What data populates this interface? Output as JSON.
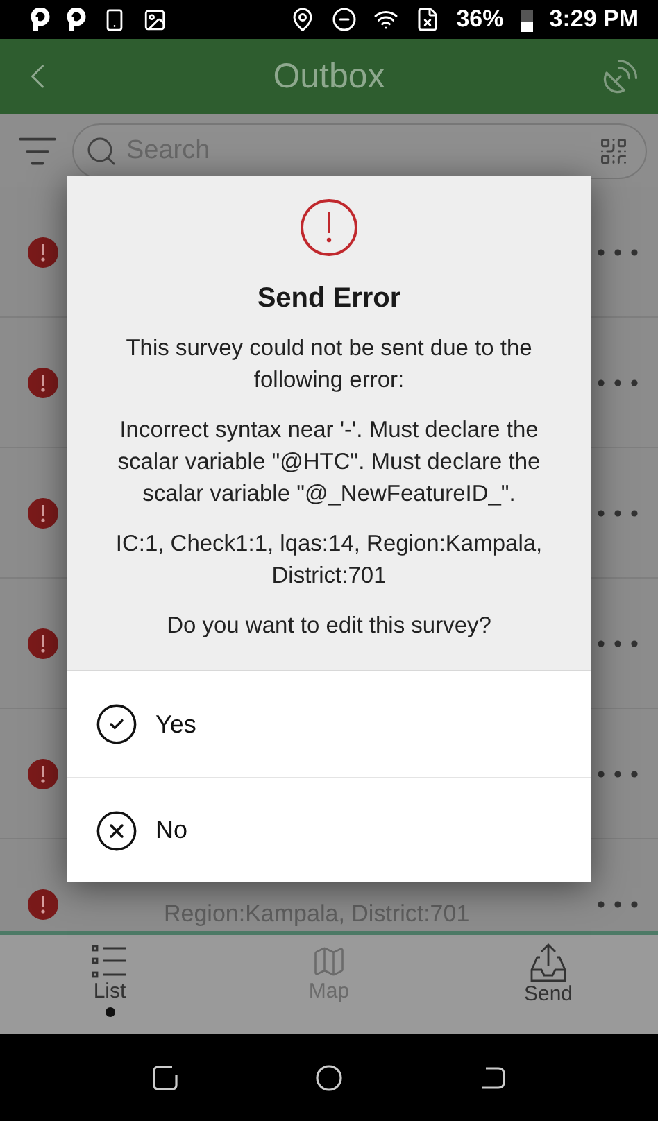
{
  "status_bar": {
    "battery": "36%",
    "time": "3:29 PM"
  },
  "app_bar": {
    "title": "Outbox"
  },
  "search": {
    "placeholder": "Search"
  },
  "outbox_rows": [
    {
      "kind": "error"
    },
    {
      "kind": "error"
    },
    {
      "kind": "error"
    },
    {
      "kind": "error"
    },
    {
      "kind": "error"
    },
    {
      "kind": "error",
      "detail": "Region:Kampala, District:701"
    }
  ],
  "dialog": {
    "title": "Send Error",
    "paragraphs": [
      "This survey could not be sent due to the following error:",
      "Incorrect syntax near '-'. Must declare the scalar variable \"@HTC\". Must declare the scalar variable \"@_NewFeatureID_\".",
      "IC:1, Check1:1, lqas:14, Region:Kampala, District:701",
      "Do you want to edit this survey?"
    ],
    "options": [
      {
        "kind": "yes",
        "label": "Yes"
      },
      {
        "kind": "no",
        "label": "No"
      }
    ]
  },
  "bottom_nav": [
    {
      "kind": "list",
      "label": "List",
      "selected": true,
      "disabled": false
    },
    {
      "kind": "map",
      "label": "Map",
      "selected": false,
      "disabled": true
    },
    {
      "kind": "send",
      "label": "Send",
      "selected": false,
      "disabled": false
    }
  ]
}
